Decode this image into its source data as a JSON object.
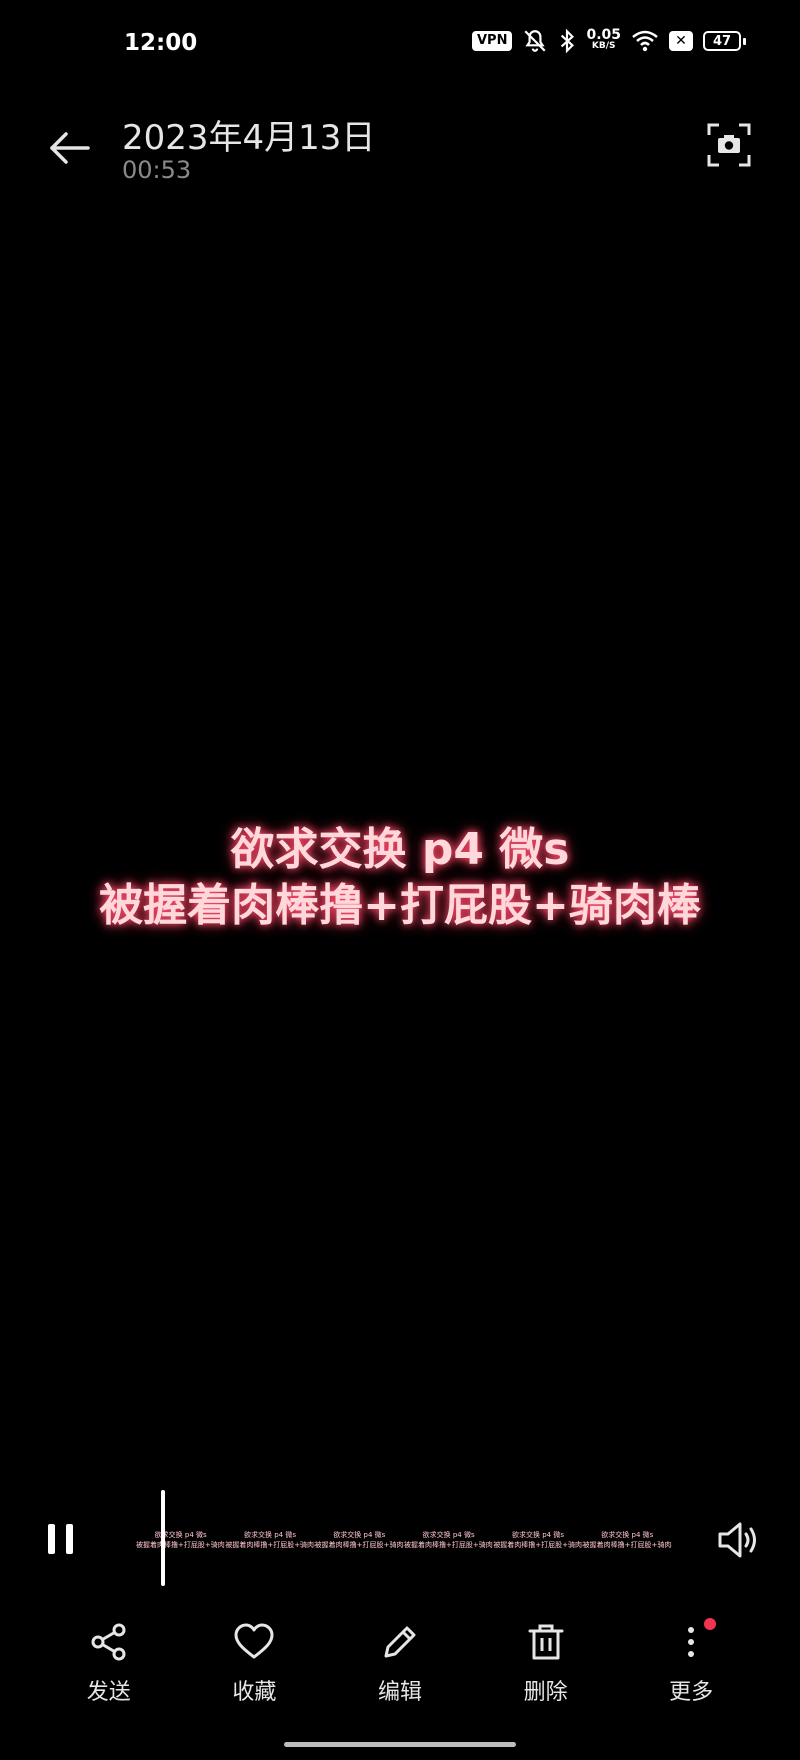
{
  "status_bar": {
    "time": "12:00",
    "vpn": "VPN",
    "net_speed_value": "0.05",
    "net_speed_unit": "KB/S",
    "x_badge": "✕",
    "battery": "47",
    "icons": [
      "vpn-icon",
      "mute-icon",
      "bluetooth-icon",
      "wifi-icon",
      "x-icon",
      "battery-icon"
    ]
  },
  "header": {
    "title": "2023年4月13日",
    "duration": "00:53",
    "icons": [
      "back-arrow-icon",
      "camera-snapshot-icon"
    ]
  },
  "video": {
    "caption_line1": "欲求交换 p4 微s",
    "caption_line2": "被握着肉棒撸+打屁股+骑肉棒",
    "accent_color": "#ff4d6d"
  },
  "player": {
    "state": "playing",
    "icons": [
      "pause-icon",
      "volume-icon"
    ],
    "thumbnails": [
      {
        "l1": "欲求交换 p4 微s",
        "l2": "被握着肉棒撸+打屁股+骑肉棒"
      },
      {
        "l1": "欲求交换 p4 微s",
        "l2": "被握着肉棒撸+打屁股+骑肉棒"
      },
      {
        "l1": "欲求交换 p4 微s",
        "l2": "被握着肉棒撸+打屁股+骑肉棒"
      },
      {
        "l1": "欲求交换 p4 微s",
        "l2": "被握着肉棒撸+打屁股+骑肉棒"
      },
      {
        "l1": "欲求交换 p4 微s",
        "l2": "被握着肉棒撸+打屁股+骑肉棒"
      },
      {
        "l1": "欲求交换 p4 微s",
        "l2": "被握着肉棒撸+打屁股+骑肉棒"
      }
    ]
  },
  "actions": [
    {
      "label": "发送",
      "icon": "share-icon"
    },
    {
      "label": "收藏",
      "icon": "heart-icon"
    },
    {
      "label": "编辑",
      "icon": "pencil-icon"
    },
    {
      "label": "删除",
      "icon": "trash-icon"
    },
    {
      "label": "更多",
      "icon": "more-icon"
    }
  ],
  "notification_color": "#f0364f"
}
